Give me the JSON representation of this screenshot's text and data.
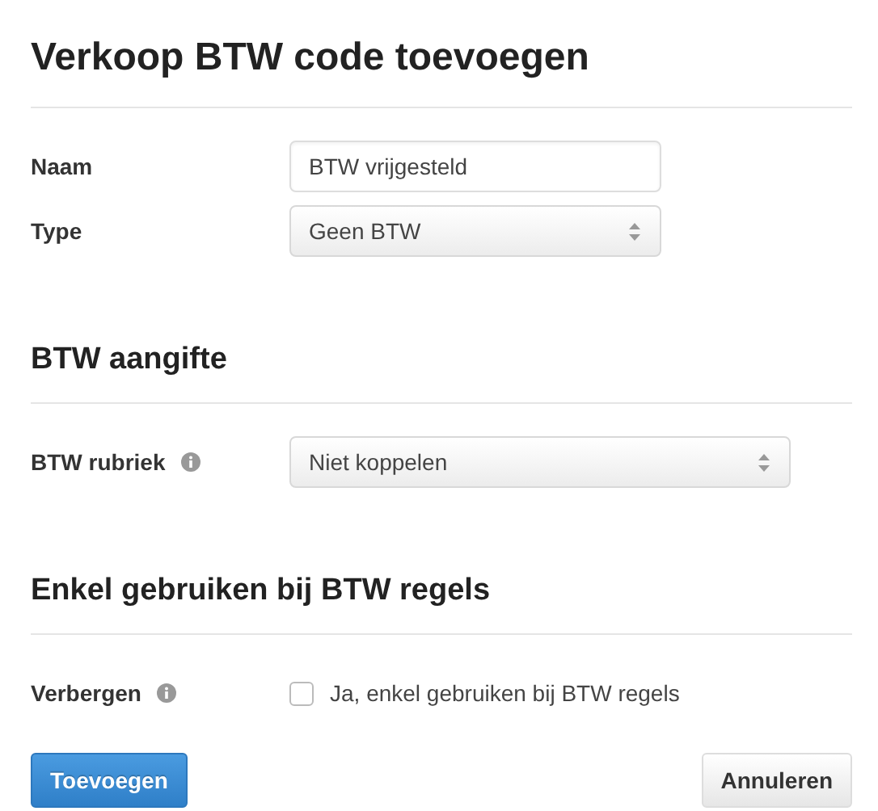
{
  "title": "Verkoop BTW code toevoegen",
  "sections": [
    {
      "fields": [
        {
          "kind": "text",
          "label": "Naam",
          "value": "BTW vrijgesteld",
          "info": false
        },
        {
          "kind": "select",
          "label": "Type",
          "value": "Geen BTW",
          "info": false
        }
      ]
    },
    {
      "heading": "BTW aangifte",
      "fields": [
        {
          "kind": "select",
          "label": "BTW rubriek",
          "value": "Niet koppelen",
          "info": true
        }
      ]
    },
    {
      "heading": "Enkel gebruiken bij BTW regels",
      "fields": [
        {
          "kind": "checkbox",
          "label": "Verbergen",
          "value": "Ja, enkel gebruiken bij BTW regels",
          "checked": false,
          "info": true
        }
      ]
    }
  ],
  "buttons": [
    {
      "label": "Toevoegen",
      "kind": "primary"
    },
    {
      "label": "Annuleren",
      "kind": "secondary"
    }
  ]
}
